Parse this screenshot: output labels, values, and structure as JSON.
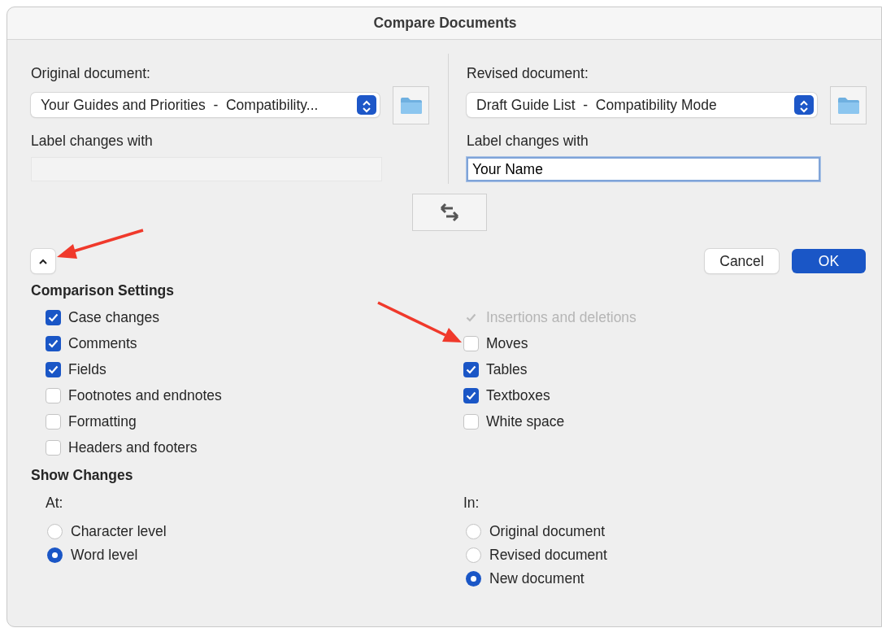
{
  "window": {
    "title": "Compare Documents"
  },
  "original": {
    "label": "Original document:",
    "value": "Your Guides and Priorities  -  Compatibility...",
    "label_changes": "Label changes with",
    "name_field": {
      "disabled": true,
      "focused": false
    }
  },
  "revised": {
    "label": "Revised document:",
    "value": "Draft Guide List  -  Compatibility Mode",
    "label_changes": "Label changes with",
    "name_field": {
      "value": "Your Name",
      "disabled": false,
      "focused": true
    }
  },
  "options_toggle": {
    "expanded": true
  },
  "buttons": [
    {
      "label": "Cancel",
      "default": false
    },
    {
      "label": "OK",
      "default": true
    }
  ],
  "comparison_settings": {
    "title": "Comparison Settings",
    "left": [
      {
        "label": "Case changes",
        "checked": true,
        "disabled": false
      },
      {
        "label": "Comments",
        "checked": true,
        "disabled": false
      },
      {
        "label": "Fields",
        "checked": true,
        "disabled": false
      },
      {
        "label": "Footnotes and endnotes",
        "checked": false,
        "disabled": false
      },
      {
        "label": "Formatting",
        "checked": false,
        "disabled": false
      },
      {
        "label": "Headers and footers",
        "checked": false,
        "disabled": false
      }
    ],
    "right": [
      {
        "label": "Insertions and deletions",
        "checked": true,
        "disabled": true
      },
      {
        "label": "Moves",
        "checked": false,
        "disabled": false
      },
      {
        "label": "Tables",
        "checked": true,
        "disabled": false
      },
      {
        "label": "Textboxes",
        "checked": true,
        "disabled": false
      },
      {
        "label": "White space",
        "checked": false,
        "disabled": false
      }
    ]
  },
  "show_changes": {
    "title": "Show Changes",
    "at": {
      "label": "At:",
      "options": [
        {
          "label": "Character level",
          "selected": false
        },
        {
          "label": "Word level",
          "selected": true
        }
      ]
    },
    "in": {
      "label": "In:",
      "options": [
        {
          "label": "Original document",
          "selected": false
        },
        {
          "label": "Revised document",
          "selected": false
        },
        {
          "label": "New document",
          "selected": true
        }
      ]
    }
  }
}
